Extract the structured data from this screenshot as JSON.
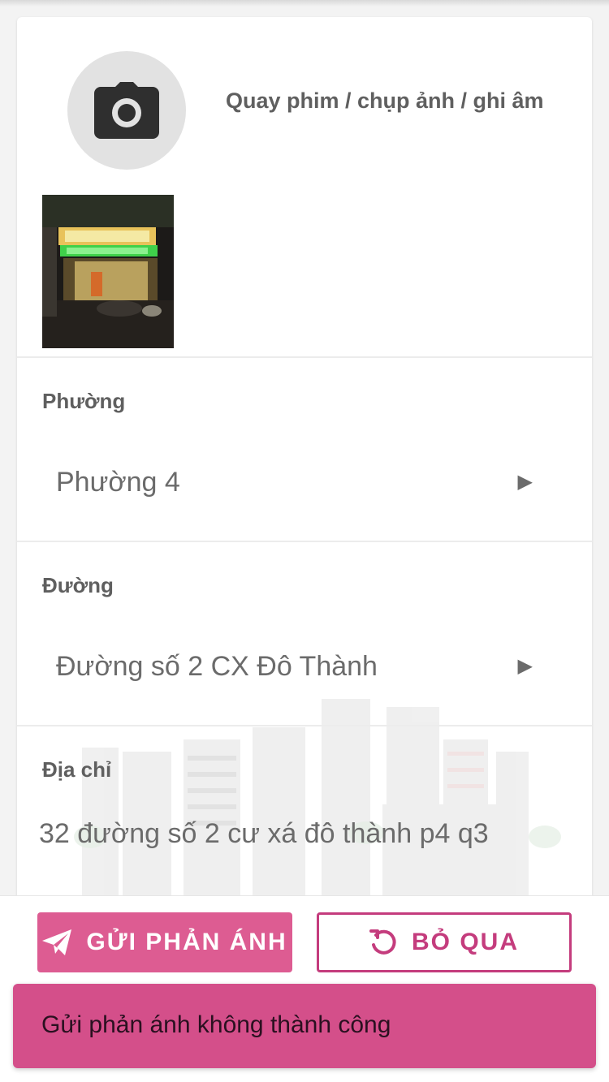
{
  "media": {
    "label": "Quay phim / chụp ảnh / ghi âm"
  },
  "ward": {
    "label": "Phường",
    "value": "Phường 4"
  },
  "street": {
    "label": "Đường",
    "value": "Đường số 2 CX Đô Thành"
  },
  "address": {
    "label": "Địa chỉ",
    "value": "32 đường số 2 cư xá đô thành p4 q3"
  },
  "actions": {
    "send_label": "GỬI PHẢN ÁNH",
    "skip_label": "BỎ QUA"
  },
  "toast": {
    "message": "Gửi phản ánh không thành công"
  },
  "colors": {
    "accent": "#dd5c92",
    "accent_dark": "#c43c7d",
    "toast": "#d44f8a",
    "label": "#5f5f5f",
    "value": "#6b6b6b"
  },
  "icons": {
    "camera": "camera-icon",
    "send": "send-icon",
    "undo": "undo-icon",
    "arrow": "triangle-right-icon"
  }
}
